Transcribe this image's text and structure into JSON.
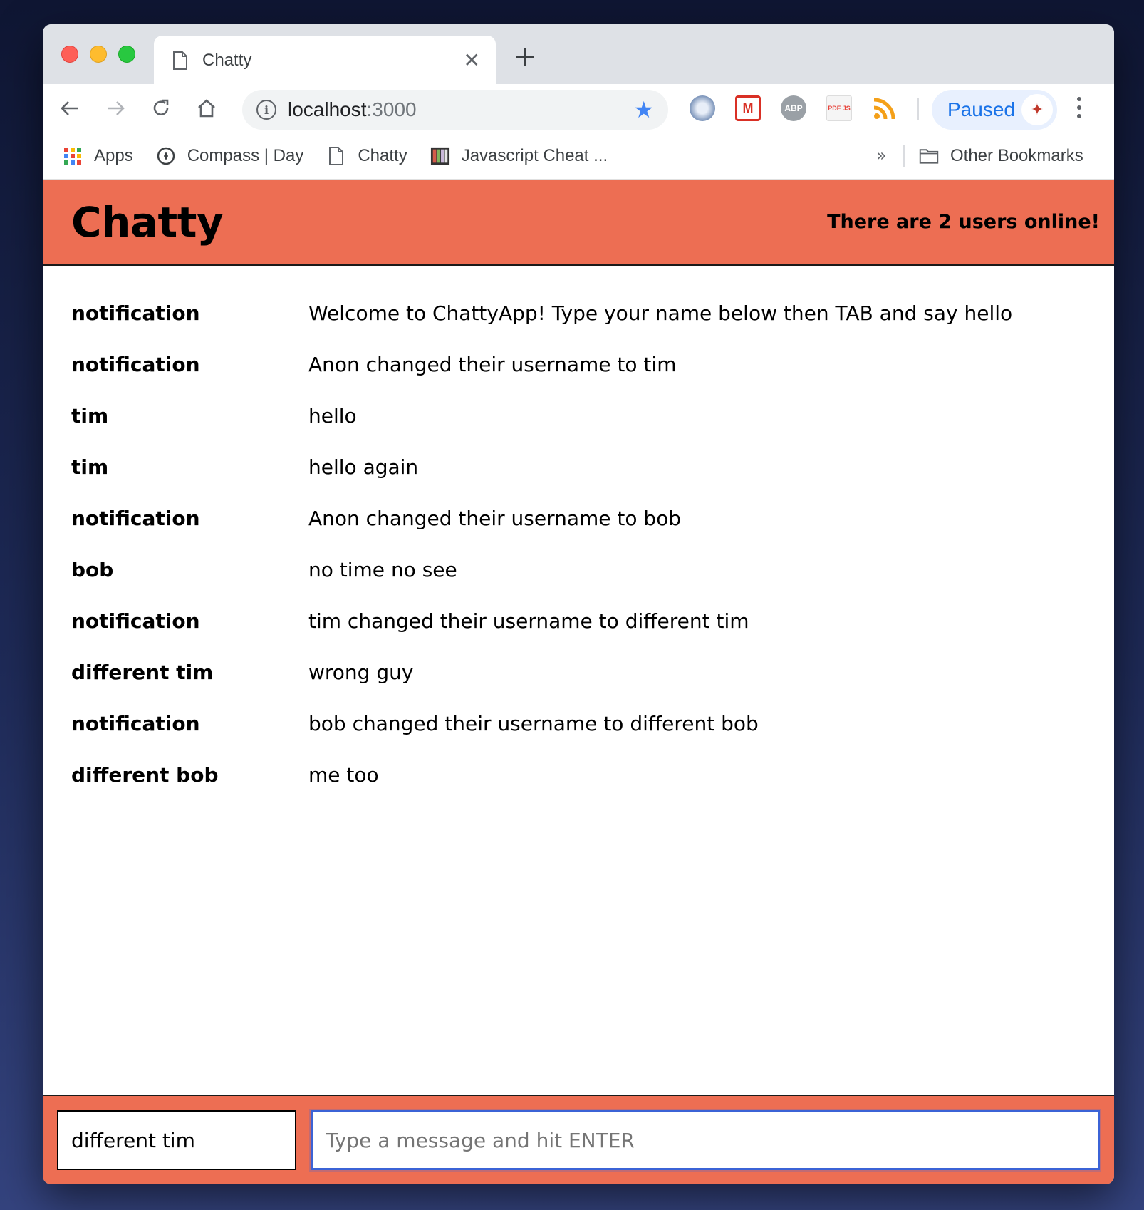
{
  "browser": {
    "tab_title": "Chatty",
    "new_tab_symbol": "+",
    "url_host": "localhost",
    "url_port": ":3000",
    "profile_label": "Paused",
    "accent": "#1a73e8",
    "extensions": [
      "orbit-icon",
      "gmail-icon",
      "adblock-plus-icon",
      "pdfjs-icon",
      "rss-feed-icon"
    ],
    "extension_labels": {
      "adblock": "ABP",
      "pdfjs": "PDF JS",
      "gmail": "M"
    }
  },
  "bookmarks": {
    "items": [
      {
        "label": "Apps",
        "icon": "apps-grid-icon"
      },
      {
        "label": "Compass | Day",
        "icon": "compass-icon"
      },
      {
        "label": "Chatty",
        "icon": "page-icon"
      },
      {
        "label": "Javascript Cheat ...",
        "icon": "notebook-icon"
      }
    ],
    "overflow": "»",
    "other": "Other Bookmarks"
  },
  "app": {
    "brand": "Chatty",
    "users_online": "There are 2 users online!",
    "header_color": "#ed6e53"
  },
  "messages": [
    {
      "user": "notification",
      "content": "Welcome to ChattyApp! Type your name below then TAB and say hello"
    },
    {
      "user": "notification",
      "content": "Anon changed their username to tim"
    },
    {
      "user": "tim",
      "content": "hello"
    },
    {
      "user": "tim",
      "content": "hello again"
    },
    {
      "user": "notification",
      "content": "Anon changed their username to bob"
    },
    {
      "user": "bob",
      "content": "no time no see"
    },
    {
      "user": "notification",
      "content": "tim changed their username to different tim"
    },
    {
      "user": "different tim",
      "content": "wrong guy"
    },
    {
      "user": "notification",
      "content": "bob changed their username to different bob"
    },
    {
      "user": "different bob",
      "content": "me too"
    }
  ],
  "chatbar": {
    "username_value": "different tim",
    "message_placeholder": "Type a message and hit ENTER"
  }
}
